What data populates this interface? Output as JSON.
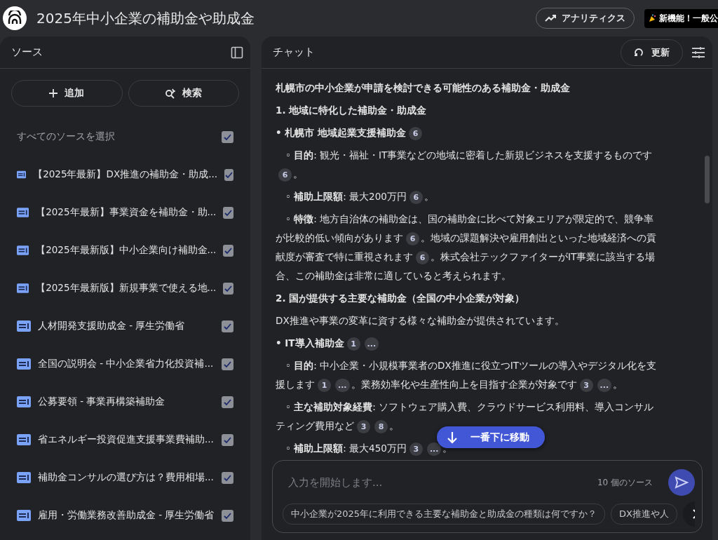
{
  "header": {
    "title": "2025年中小企業の補助金や助成金",
    "analytics_button": "アナリティクス",
    "announcement": "新機能！一般公"
  },
  "sources": {
    "title": "ソース",
    "add_button": "追加",
    "search_button": "検索",
    "select_all": {
      "label": "すべてのソースを選択",
      "checked": true
    },
    "items": [
      {
        "title": "【2025年最新】DX推進の補助金・助成...",
        "checked": true
      },
      {
        "title": "【2025年最新】事業資金を補助金・助...",
        "checked": true
      },
      {
        "title": "【2025年最新版】中小企業向け補助金...",
        "checked": true
      },
      {
        "title": "【2025年最新版】新規事業で使える地...",
        "checked": true
      },
      {
        "title": "人材開発支援助成金 - 厚生労働省",
        "checked": true
      },
      {
        "title": "全国の説明会 - 中小企業省力化投資補...",
        "checked": true
      },
      {
        "title": "公募要領 - 事業再構築補助金",
        "checked": true
      },
      {
        "title": "省エネルギー投資促進支援事業費補助...",
        "checked": true
      },
      {
        "title": "補助金コンサルの選び方は？費用相場...",
        "checked": true
      },
      {
        "title": "雇用・労働業務改善助成金 - 厚生労働省",
        "checked": true
      }
    ]
  },
  "chat": {
    "title": "チャット",
    "refresh_button": "更新",
    "blocks": [
      {
        "kind": "heading",
        "parts": [
          {
            "kind": "text",
            "text": "札幌市の中小企業が申請を検討できる可能性のある補助金・助成金"
          }
        ]
      },
      {
        "kind": "heading",
        "parts": [
          {
            "kind": "text",
            "text": "1. 地域に特化した補助金・助成金"
          }
        ]
      },
      {
        "kind": "bullet",
        "parts": [
          {
            "kind": "text",
            "text": "• **札幌市 地域起業支援補助金**"
          },
          {
            "kind": "cite",
            "label": "6"
          }
        ]
      },
      {
        "kind": "sub",
        "parts": [
          {
            "kind": "text",
            "text": "◦ **目的**: 観光・福祉・IT事業などの地域に密着した新規ビジネスを支援するものです"
          },
          {
            "kind": "cite",
            "label": "6"
          },
          {
            "kind": "text",
            "text": "。"
          }
        ]
      },
      {
        "kind": "sub",
        "parts": [
          {
            "kind": "text",
            "text": "◦ **補助上限額**: 最大200万円"
          },
          {
            "kind": "cite",
            "label": "6"
          },
          {
            "kind": "text",
            "text": "。"
          }
        ]
      },
      {
        "kind": "sub",
        "parts": [
          {
            "kind": "text",
            "text": "◦ **特徴**: 地方自治体の補助金は、国の補助金に比べて対象エリアが限定的で、競争率が比較的低い傾向があります"
          },
          {
            "kind": "cite",
            "label": "6"
          },
          {
            "kind": "text",
            "text": "。地域の課題解決や雇用創出といった地域経済への貢献度が審査で特に重視されます"
          },
          {
            "kind": "cite",
            "label": "6"
          },
          {
            "kind": "text",
            "text": "。株式会社テックファイターがIT事業に該当する場合、この補助金は非常に適していると考えられます。"
          }
        ]
      },
      {
        "kind": "heading",
        "parts": [
          {
            "kind": "text",
            "text": "2. 国が提供する主要な補助金（全国の中小企業が対象）"
          }
        ]
      },
      {
        "kind": "text",
        "parts": [
          {
            "kind": "text",
            "text": "DX推進や事業の変革に資する様々な補助金が提供されています。"
          }
        ]
      },
      {
        "kind": "bullet",
        "parts": [
          {
            "kind": "text",
            "text": "• **IT導入補助金**"
          },
          {
            "kind": "cite",
            "label": "1"
          },
          {
            "kind": "cite",
            "label": "..."
          }
        ]
      },
      {
        "kind": "sub",
        "parts": [
          {
            "kind": "text",
            "text": "◦ **目的**: 中小企業・小規模事業者のDX推進に役立つITツールの導入やデジタル化を支援します"
          },
          {
            "kind": "cite",
            "label": "1"
          },
          {
            "kind": "cite",
            "label": "..."
          },
          {
            "kind": "text",
            "text": "。業務効率化や生産性向上を目指す企業が対象です"
          },
          {
            "kind": "cite",
            "label": "3"
          },
          {
            "kind": "cite",
            "label": "..."
          },
          {
            "kind": "text",
            "text": "。"
          }
        ]
      },
      {
        "kind": "sub",
        "parts": [
          {
            "kind": "text",
            "text": "◦ **主な補助対象経費**: ソフトウェア購入費、クラウドサービス利用料、導入コンサルティング費用など"
          },
          {
            "kind": "cite",
            "label": "3"
          },
          {
            "kind": "cite",
            "label": "8"
          },
          {
            "kind": "text",
            "text": "。"
          }
        ]
      },
      {
        "kind": "sub",
        "parts": [
          {
            "kind": "text",
            "text": "◦ **補助上限額**: 最大450万円"
          },
          {
            "kind": "cite",
            "label": "3"
          },
          {
            "kind": "cite",
            "label": "..."
          },
          {
            "kind": "text",
            "text": "。"
          }
        ]
      }
    ],
    "jump_button": "一番下に移動",
    "input": {
      "placeholder": "入力を開始します...",
      "source_count": "10 個のソース"
    },
    "suggestions": [
      "中小企業が2025年に利用できる主要な補助金と助成金の種類は何ですか？",
      "DX推進や人"
    ]
  }
}
